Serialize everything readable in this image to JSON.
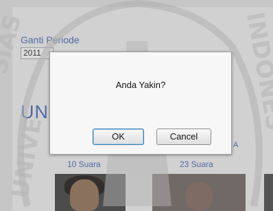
{
  "page": {
    "period_label": "Ganti Periode",
    "period_value": "2011",
    "heading": "UNI",
    "candidate_right_name": "A",
    "candidates": [
      {
        "votes": "10 Suara"
      },
      {
        "votes": "23 Suara"
      }
    ]
  },
  "dialog": {
    "message": "Anda Yakin?",
    "ok_label": "OK",
    "cancel_label": "Cancel"
  },
  "colors": {
    "link": "#3a63a8",
    "dialog_bg": "#f7f7f7",
    "ok_focus": "#3c7fb1"
  }
}
